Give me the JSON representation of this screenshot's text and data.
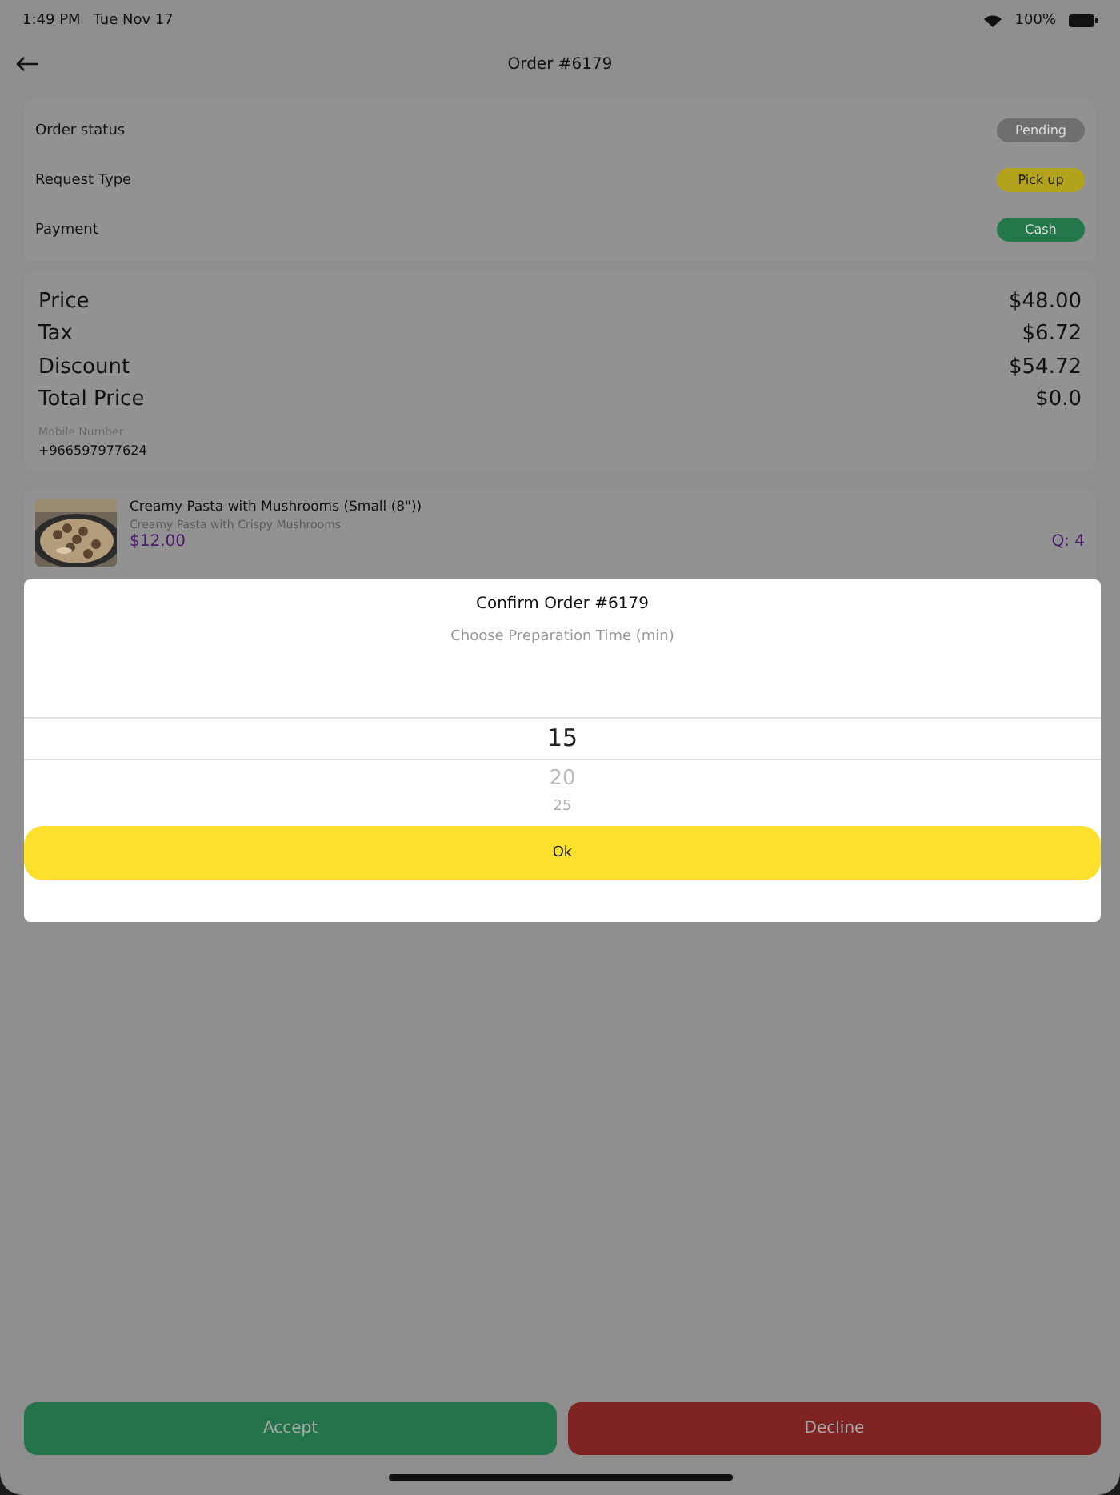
{
  "status_bar": {
    "time": "1:49 PM",
    "date": "Tue Nov 17",
    "battery": "100%"
  },
  "nav": {
    "title": "Order #6179"
  },
  "info": [
    {
      "label": "Order status",
      "value": "Pending",
      "color": "#6e6e6e"
    },
    {
      "label": "Request Type",
      "value": "Pick up",
      "color": "#b3a21c"
    },
    {
      "label": "Payment",
      "value": "Cash",
      "color": "#23784b"
    }
  ],
  "totals": [
    {
      "label": "Price",
      "value": "$48.00"
    },
    {
      "label": "Tax",
      "value": "$6.72"
    },
    {
      "label": "Discount",
      "value": "$54.72"
    },
    {
      "label": "Total Price",
      "value": "$0.0"
    }
  ],
  "mobile": {
    "label": "Mobile Number",
    "value": "+966597977624"
  },
  "items": [
    {
      "kind": "picture",
      "name": "Creamy Pasta with Mushrooms (Small (8\"))",
      "description": "Creamy Pasta with Crispy Mushrooms",
      "price": "$12.00",
      "quantity": "Q: 4"
    }
  ],
  "dialog": {
    "title": "Confirm Order #6179",
    "subtitle": "Choose Preparation Time (min)",
    "options": [
      {
        "label": "15",
        "selected": true
      },
      {
        "label": "20",
        "selected": false
      },
      {
        "label": "25",
        "selected": false
      }
    ],
    "ok": "Ok"
  },
  "actions": [
    {
      "label": "Accept",
      "color": "#23744a"
    },
    {
      "label": "Decline",
      "color": "#7f2323"
    }
  ]
}
